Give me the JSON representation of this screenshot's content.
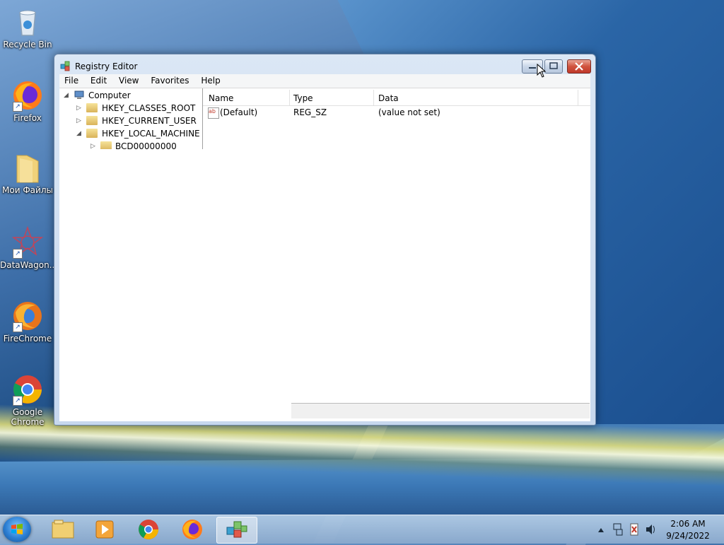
{
  "desktop": {
    "icons": [
      {
        "label": "Recycle Bin",
        "icon": "recycle-bin-icon"
      },
      {
        "label": "Firefox",
        "icon": "firefox-icon"
      },
      {
        "label": "Мои Файлы",
        "icon": "folder-icon"
      },
      {
        "label": "DataWagon...",
        "icon": "datawagon-icon"
      },
      {
        "label": "FireChrome",
        "icon": "firechrome-icon"
      },
      {
        "label": "Google Chrome",
        "icon": "chrome-icon"
      }
    ]
  },
  "window": {
    "title": "Registry Editor",
    "menu": [
      "File",
      "Edit",
      "View",
      "Favorites",
      "Help"
    ],
    "tree": [
      {
        "label": "Computer",
        "level": 0,
        "expanded": true
      },
      {
        "label": "HKEY_CLASSES_ROOT",
        "level": 1,
        "expanded": false
      },
      {
        "label": "HKEY_CURRENT_USER",
        "level": 1,
        "expanded": false
      },
      {
        "label": "HKEY_LOCAL_MACHINE",
        "level": 1,
        "expanded": true
      },
      {
        "label": "BCD00000000",
        "level": 2,
        "expanded": false
      }
    ],
    "columns": [
      "Name",
      "Type",
      "Data"
    ],
    "rows": [
      {
        "name": "(Default)",
        "type": "REG_SZ",
        "data": "(value not set)"
      }
    ]
  },
  "taskbar": {
    "apps": [
      {
        "name": "explorer",
        "icon": "folder-icon"
      },
      {
        "name": "media-player",
        "icon": "media-player-icon"
      },
      {
        "name": "chrome",
        "icon": "chrome-icon"
      },
      {
        "name": "firefox",
        "icon": "firefox-icon"
      },
      {
        "name": "regedit",
        "icon": "registry-editor-icon",
        "active": true
      }
    ],
    "clock": {
      "time": "2:06 AM",
      "date": "9/24/2022"
    }
  },
  "colors": {
    "accent": "#3d78b3",
    "close": "#c0392b"
  }
}
